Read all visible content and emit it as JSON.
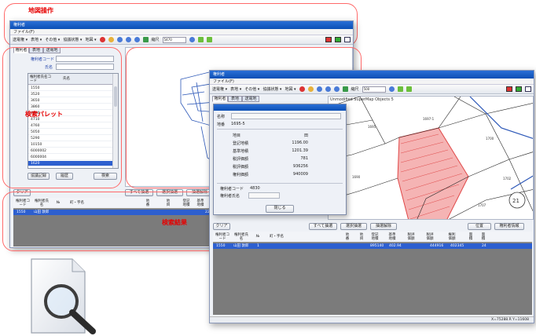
{
  "callouts": {
    "map_op": "地図操作",
    "search_panel": "検索パレット",
    "search_result": "検索結果"
  },
  "main_window": {
    "title": "権利者",
    "menu": "ファイル(F)",
    "toolbar": {
      "items": [
        "送電権 ▾",
        "表地 ▾",
        "その他 ▾",
        "協議状態 ▾",
        "地図 ▾"
      ],
      "scale_label": "縮尺",
      "scale_value": "5470"
    },
    "tabs": [
      "権利者",
      "表地",
      "送電地"
    ],
    "fields": {
      "owner_code_label": "権利者コード",
      "name_label": "氏名"
    },
    "list": {
      "headers": [
        "権利者氏名コード",
        "氏名"
      ],
      "rows": [
        "1550",
        "3520",
        "3650",
        "3860",
        "4690",
        "4710",
        "4760",
        "5050",
        "5290",
        "10150",
        "6000002",
        "6000004",
        "1620"
      ]
    },
    "buttons": {
      "agreement_record": "協議記録",
      "history": "履歴",
      "search": "検索",
      "clear": "クリア",
      "select_all": "すべて抽選",
      "select_filter": "選択抽選",
      "filter_clear": "抽選解除"
    },
    "result": {
      "headers": [
        "権利者コード",
        "権利者氏名",
        "№",
        "町・字名",
        "地番",
        "地目",
        "登記地積",
        "基準地積"
      ],
      "row": {
        "code": "1550",
        "name": "山田 敦郎",
        "land_area": "22.00"
      }
    }
  },
  "second_window": {
    "title": "権利者",
    "menu": "ファイル(F)",
    "toolbar": {
      "items": [
        "送電権 ▾",
        "表地 ▾",
        "その他 ▾",
        "協議状態 ▾",
        "地図 ▾"
      ],
      "scale_label": "縮尺",
      "scale_value": "500"
    },
    "tabs": [
      "権利者",
      "表地",
      "送電地"
    ],
    "map_title": "Unmodified SuperMap Objects 5",
    "dialog": {
      "name_label": "名称",
      "chiban_label": "地番",
      "chiban_value": "1695-5",
      "rows": [
        {
          "label": "地目",
          "value": "田"
        },
        {
          "label": "登記地積",
          "value": "1196.00"
        },
        {
          "label": "基準地積",
          "value": "1201.39"
        },
        {
          "label": "税評価額",
          "value": "781"
        },
        {
          "label": "税評価額",
          "value": "936256"
        },
        {
          "label": "権利価額",
          "value": "940009"
        }
      ],
      "owner_code_label": "権利者コード",
      "owner_code_value": "4830",
      "owner_name_label": "権利者氏名",
      "close": "閉じる"
    },
    "buttons": {
      "clear": "クリア",
      "select_all": "すべて抽選",
      "select_filter": "選択抽選",
      "filter_clear": "抽選解除",
      "location": "位置",
      "owner_info": "権利者情報"
    },
    "result": {
      "headers": [
        "権利者コード",
        "権利者氏名",
        "№",
        "町・字名",
        "地番",
        "地目",
        "登記地積",
        "基準地積",
        "税評価額",
        "税評価額",
        "権利価額",
        "面積",
        "面積"
      ],
      "row": {
        "code": "1550",
        "name": "山田 敦郎",
        "a": "1",
        "b": "895140",
        "c": "402.94",
        "d": "444916",
        "e": "402345",
        "f": "24"
      }
    },
    "status": "X=75288.R   Y=11608"
  },
  "colors": {
    "callout": "#e60000",
    "titlebar": "#0b4fb5",
    "selected_row": "#2d5fcf",
    "parcel_highlight": "#f5b4b4"
  }
}
